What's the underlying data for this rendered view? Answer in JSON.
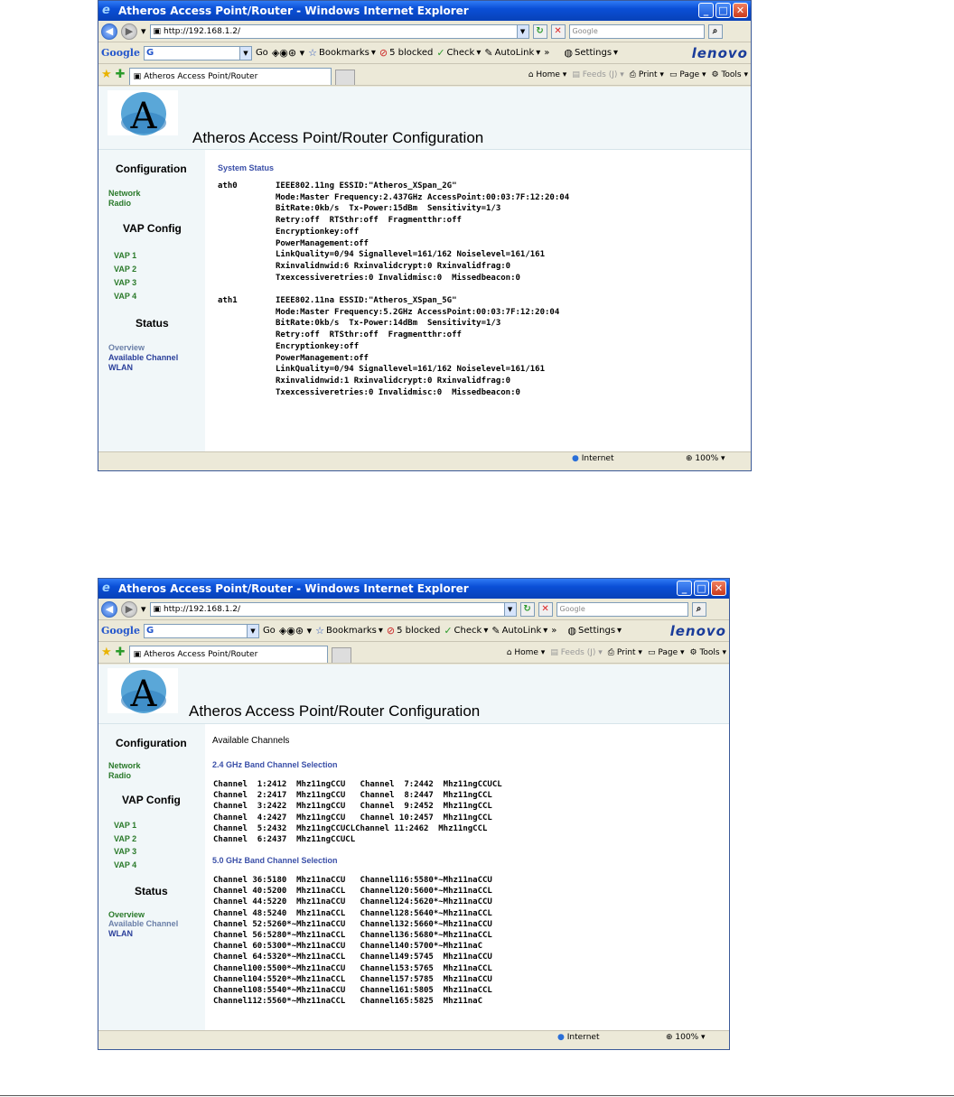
{
  "browser": {
    "title": "Atheros Access Point/Router - Windows Internet Explorer",
    "url": "http://192.168.1.2/",
    "search_placeholder": "Google",
    "tab_label": "Atheros Access Point/Router",
    "google_logo": "Google",
    "google_field": "G",
    "go_label": "Go",
    "bookmarks_label": "Bookmarks",
    "blocked_label": "5 blocked",
    "check_label": "Check",
    "autolink_label": "AutoLink",
    "more_label": "»",
    "settings_label": "Settings",
    "brand": "lenovo",
    "home_label": "Home",
    "feeds_label": "Feeds (J)",
    "print_label": "Print",
    "page_label": "Page",
    "tools_label": "Tools",
    "status_zone": "Internet",
    "zoom": "100%"
  },
  "app": {
    "title": "Atheros Access Point/Router Configuration",
    "logo_letter": "A"
  },
  "sidebar": {
    "configuration": "Configuration",
    "network": "Network",
    "radio": "Radio",
    "vap_config": "VAP Config",
    "vap": [
      "VAP 1",
      "VAP 2",
      "VAP 3",
      "VAP 4"
    ],
    "status": "Status",
    "overview": "Overview",
    "available_channel": "Available Channel",
    "wlan": "WLAN"
  },
  "screen1": {
    "section_title": "System Status",
    "ath0_label": "ath0",
    "ath0_lines": "IEEE802.11ng ESSID:\"Atheros_XSpan_2G\"\nMode:Master Frequency:2.437GHz AccessPoint:00:03:7F:12:20:04\nBitRate:0kb/s  Tx-Power:15dBm  Sensitivity=1/3\nRetry:off  RTSthr:off  Fragmentthr:off\nEncryptionkey:off\nPowerManagement:off\nLinkQuality=0/94 Signallevel=161/162 Noiselevel=161/161\nRxinvalidnwid:6 Rxinvalidcrypt:0 Rxinvalidfrag:0\nTxexcessiveretries:0 Invalidmisc:0  Missedbeacon:0",
    "ath1_label": "ath1",
    "ath1_lines": "IEEE802.11na ESSID:\"Atheros_XSpan_5G\"\nMode:Master Frequency:5.2GHz AccessPoint:00:03:7F:12:20:04\nBitRate:0kb/s  Tx-Power:14dBm  Sensitivity=1/3\nRetry:off  RTSthr:off  Fragmentthr:off\nEncryptionkey:off\nPowerManagement:off\nLinkQuality=0/94 Signallevel=161/162 Noiselevel=161/161\nRxinvalidnwid:1 Rxinvalidcrypt:0 Rxinvalidfrag:0\nTxexcessiveretries:0 Invalidmisc:0  Missedbeacon:0"
  },
  "screen2": {
    "heading": "Available Channels",
    "band24_title": "2.4 GHz Band Channel Selection",
    "band24_lines": "Channel  1:2412  Mhz11ngCCU   Channel  7:2442  Mhz11ngCCUCL\nChannel  2:2417  Mhz11ngCCU   Channel  8:2447  Mhz11ngCCL\nChannel  3:2422  Mhz11ngCCU   Channel  9:2452  Mhz11ngCCL\nChannel  4:2427  Mhz11ngCCU   Channel 10:2457  Mhz11ngCCL\nChannel  5:2432  Mhz11ngCCUCLChannel 11:2462  Mhz11ngCCL\nChannel  6:2437  Mhz11ngCCUCL",
    "band5_title": "5.0 GHz Band Channel Selection",
    "band5_lines": "Channel 36:5180  Mhz11naCCU   Channel116:5580*~Mhz11naCCU\nChannel 40:5200  Mhz11naCCL   Channel120:5600*~Mhz11naCCL\nChannel 44:5220  Mhz11naCCU   Channel124:5620*~Mhz11naCCU\nChannel 48:5240  Mhz11naCCL   Channel128:5640*~Mhz11naCCL\nChannel 52:5260*~Mhz11naCCU   Channel132:5660*~Mhz11naCCU\nChannel 56:5280*~Mhz11naCCL   Channel136:5680*~Mhz11naCCL\nChannel 60:5300*~Mhz11naCCU   Channel140:5700*~Mhz11naC\nChannel 64:5320*~Mhz11naCCL   Channel149:5745  Mhz11naCCU\nChannel100:5500*~Mhz11naCCU   Channel153:5765  Mhz11naCCL\nChannel104:5520*~Mhz11naCCL   Channel157:5785  Mhz11naCCU\nChannel108:5540*~Mhz11naCCU   Channel161:5805  Mhz11naCCL\nChannel112:5560*~Mhz11naCCL   Channel165:5825  Mhz11naC"
  },
  "colors": {
    "titlebar": "#0a4fd6",
    "header_bg": "#f1f7f9",
    "link_green": "#2a7a2a",
    "link_blue": "#2a3f9a",
    "section_title": "#3a4fa8"
  }
}
